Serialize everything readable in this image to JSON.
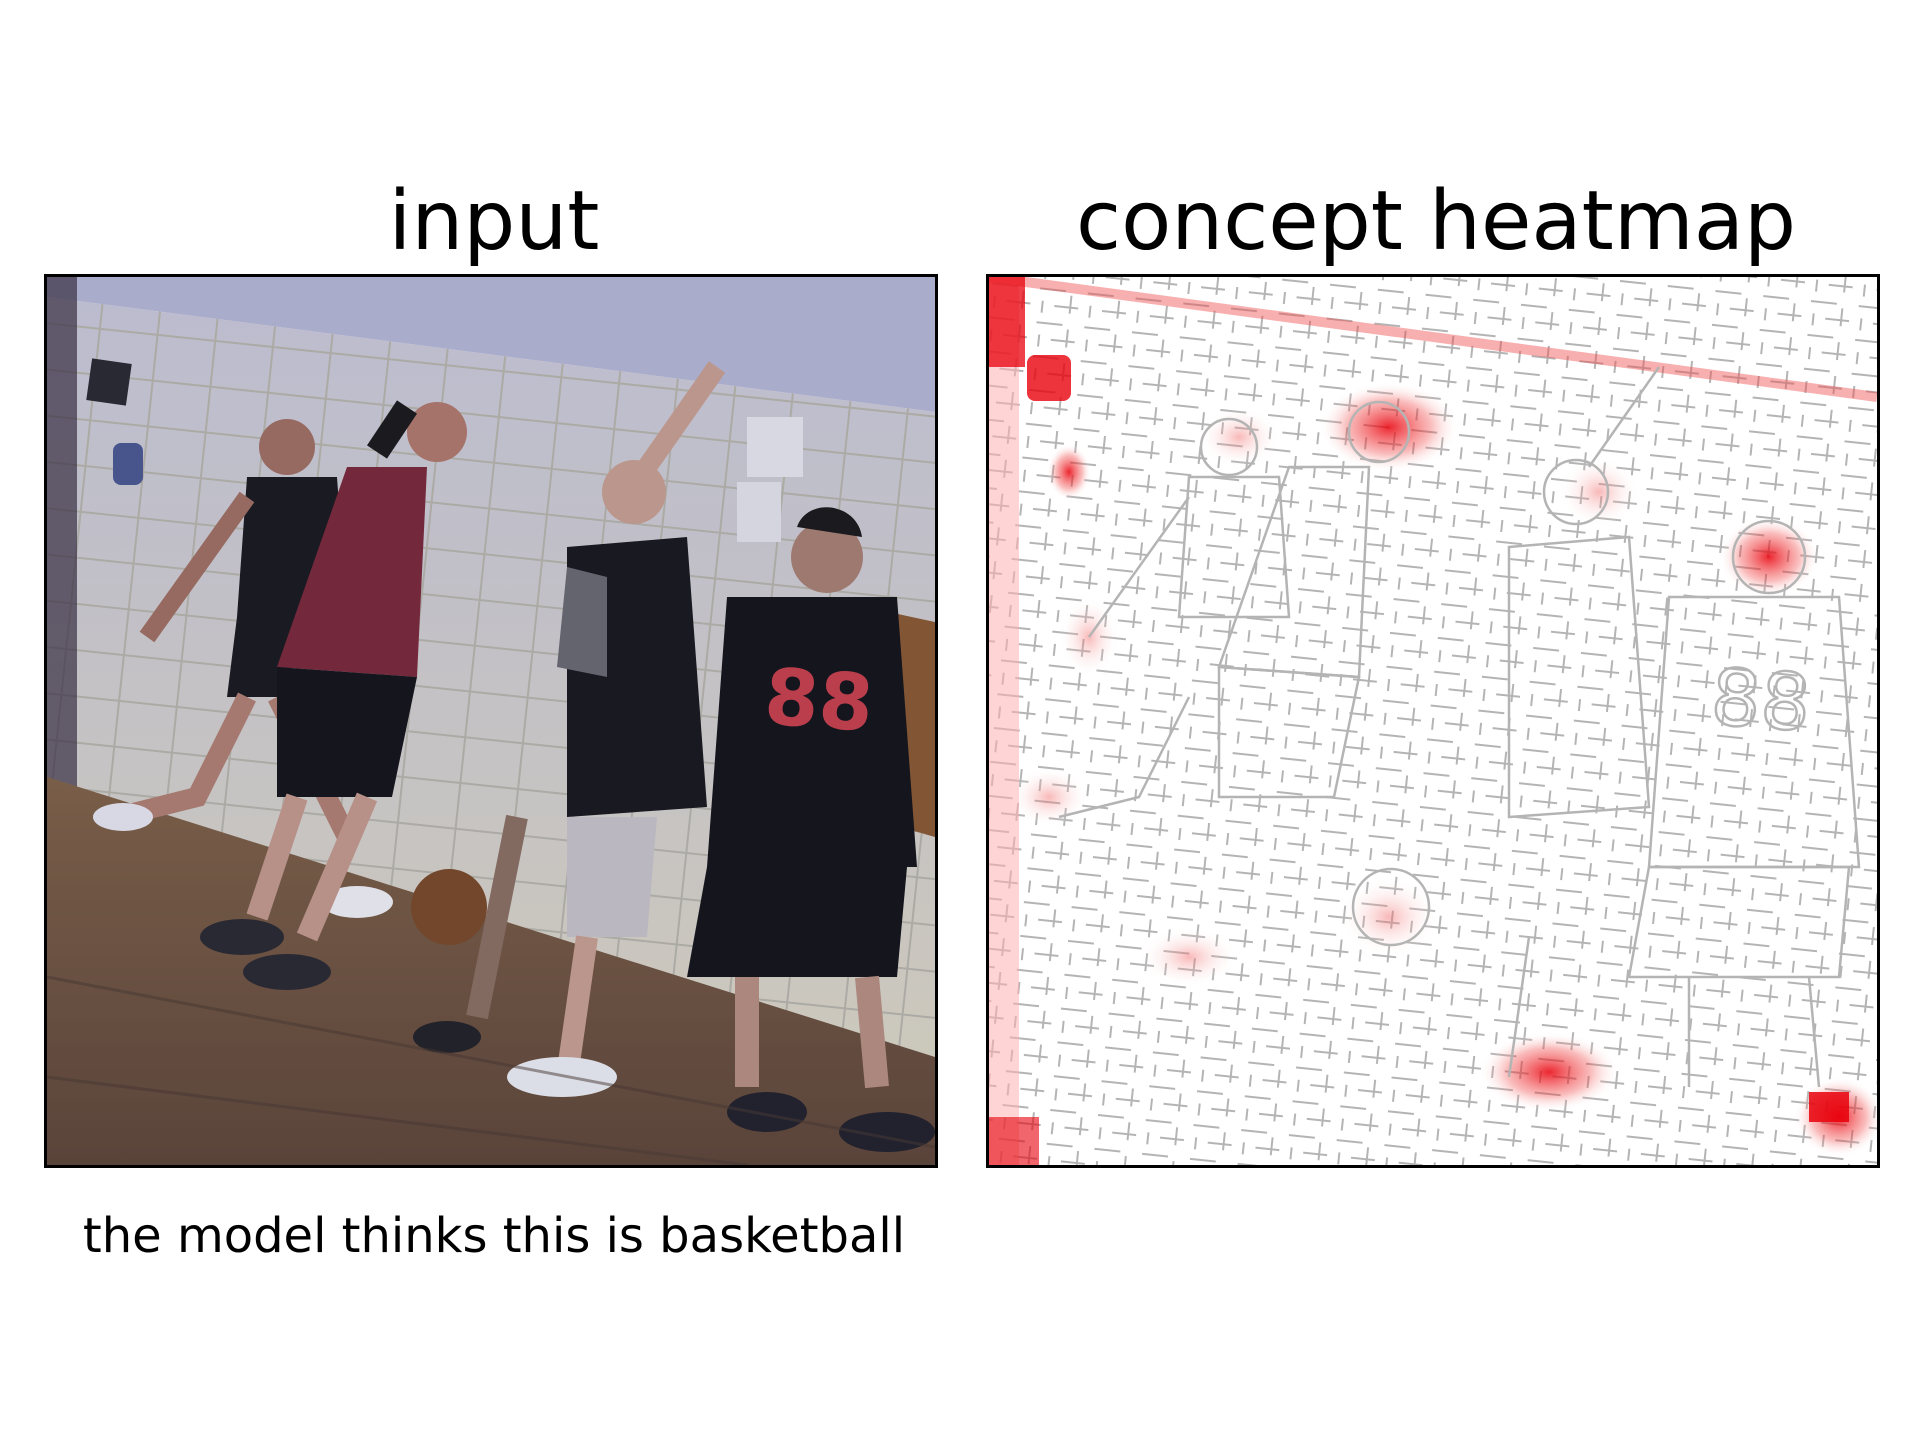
{
  "panels": {
    "input": {
      "title": "input",
      "image_description": "photo",
      "jersey_number": "88"
    },
    "heatmap": {
      "title": "concept heatmap",
      "jersey_number": "88",
      "highlight_color": "#e8000b",
      "edge_color": "#b4b4b4"
    }
  },
  "caption": "the model thinks this is basketball"
}
